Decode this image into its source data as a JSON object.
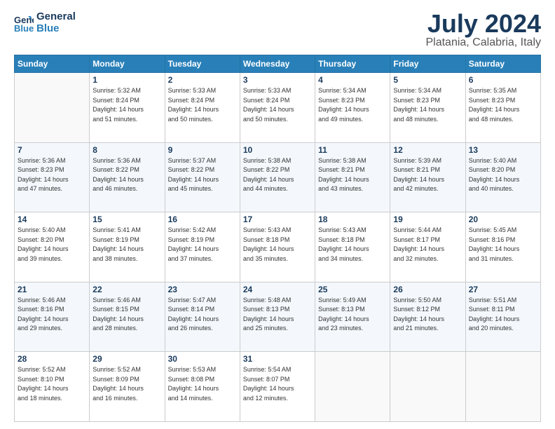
{
  "logo": {
    "line1": "General",
    "line2": "Blue"
  },
  "title": "July 2024",
  "subtitle": "Platania, Calabria, Italy",
  "weekdays": [
    "Sunday",
    "Monday",
    "Tuesday",
    "Wednesday",
    "Thursday",
    "Friday",
    "Saturday"
  ],
  "weeks": [
    [
      {
        "day": "",
        "info": ""
      },
      {
        "day": "1",
        "info": "Sunrise: 5:32 AM\nSunset: 8:24 PM\nDaylight: 14 hours\nand 51 minutes."
      },
      {
        "day": "2",
        "info": "Sunrise: 5:33 AM\nSunset: 8:24 PM\nDaylight: 14 hours\nand 50 minutes."
      },
      {
        "day": "3",
        "info": "Sunrise: 5:33 AM\nSunset: 8:24 PM\nDaylight: 14 hours\nand 50 minutes."
      },
      {
        "day": "4",
        "info": "Sunrise: 5:34 AM\nSunset: 8:23 PM\nDaylight: 14 hours\nand 49 minutes."
      },
      {
        "day": "5",
        "info": "Sunrise: 5:34 AM\nSunset: 8:23 PM\nDaylight: 14 hours\nand 48 minutes."
      },
      {
        "day": "6",
        "info": "Sunrise: 5:35 AM\nSunset: 8:23 PM\nDaylight: 14 hours\nand 48 minutes."
      }
    ],
    [
      {
        "day": "7",
        "info": "Sunrise: 5:36 AM\nSunset: 8:23 PM\nDaylight: 14 hours\nand 47 minutes."
      },
      {
        "day": "8",
        "info": "Sunrise: 5:36 AM\nSunset: 8:22 PM\nDaylight: 14 hours\nand 46 minutes."
      },
      {
        "day": "9",
        "info": "Sunrise: 5:37 AM\nSunset: 8:22 PM\nDaylight: 14 hours\nand 45 minutes."
      },
      {
        "day": "10",
        "info": "Sunrise: 5:38 AM\nSunset: 8:22 PM\nDaylight: 14 hours\nand 44 minutes."
      },
      {
        "day": "11",
        "info": "Sunrise: 5:38 AM\nSunset: 8:21 PM\nDaylight: 14 hours\nand 43 minutes."
      },
      {
        "day": "12",
        "info": "Sunrise: 5:39 AM\nSunset: 8:21 PM\nDaylight: 14 hours\nand 42 minutes."
      },
      {
        "day": "13",
        "info": "Sunrise: 5:40 AM\nSunset: 8:20 PM\nDaylight: 14 hours\nand 40 minutes."
      }
    ],
    [
      {
        "day": "14",
        "info": "Sunrise: 5:40 AM\nSunset: 8:20 PM\nDaylight: 14 hours\nand 39 minutes."
      },
      {
        "day": "15",
        "info": "Sunrise: 5:41 AM\nSunset: 8:19 PM\nDaylight: 14 hours\nand 38 minutes."
      },
      {
        "day": "16",
        "info": "Sunrise: 5:42 AM\nSunset: 8:19 PM\nDaylight: 14 hours\nand 37 minutes."
      },
      {
        "day": "17",
        "info": "Sunrise: 5:43 AM\nSunset: 8:18 PM\nDaylight: 14 hours\nand 35 minutes."
      },
      {
        "day": "18",
        "info": "Sunrise: 5:43 AM\nSunset: 8:18 PM\nDaylight: 14 hours\nand 34 minutes."
      },
      {
        "day": "19",
        "info": "Sunrise: 5:44 AM\nSunset: 8:17 PM\nDaylight: 14 hours\nand 32 minutes."
      },
      {
        "day": "20",
        "info": "Sunrise: 5:45 AM\nSunset: 8:16 PM\nDaylight: 14 hours\nand 31 minutes."
      }
    ],
    [
      {
        "day": "21",
        "info": "Sunrise: 5:46 AM\nSunset: 8:16 PM\nDaylight: 14 hours\nand 29 minutes."
      },
      {
        "day": "22",
        "info": "Sunrise: 5:46 AM\nSunset: 8:15 PM\nDaylight: 14 hours\nand 28 minutes."
      },
      {
        "day": "23",
        "info": "Sunrise: 5:47 AM\nSunset: 8:14 PM\nDaylight: 14 hours\nand 26 minutes."
      },
      {
        "day": "24",
        "info": "Sunrise: 5:48 AM\nSunset: 8:13 PM\nDaylight: 14 hours\nand 25 minutes."
      },
      {
        "day": "25",
        "info": "Sunrise: 5:49 AM\nSunset: 8:13 PM\nDaylight: 14 hours\nand 23 minutes."
      },
      {
        "day": "26",
        "info": "Sunrise: 5:50 AM\nSunset: 8:12 PM\nDaylight: 14 hours\nand 21 minutes."
      },
      {
        "day": "27",
        "info": "Sunrise: 5:51 AM\nSunset: 8:11 PM\nDaylight: 14 hours\nand 20 minutes."
      }
    ],
    [
      {
        "day": "28",
        "info": "Sunrise: 5:52 AM\nSunset: 8:10 PM\nDaylight: 14 hours\nand 18 minutes."
      },
      {
        "day": "29",
        "info": "Sunrise: 5:52 AM\nSunset: 8:09 PM\nDaylight: 14 hours\nand 16 minutes."
      },
      {
        "day": "30",
        "info": "Sunrise: 5:53 AM\nSunset: 8:08 PM\nDaylight: 14 hours\nand 14 minutes."
      },
      {
        "day": "31",
        "info": "Sunrise: 5:54 AM\nSunset: 8:07 PM\nDaylight: 14 hours\nand 12 minutes."
      },
      {
        "day": "",
        "info": ""
      },
      {
        "day": "",
        "info": ""
      },
      {
        "day": "",
        "info": ""
      }
    ]
  ]
}
